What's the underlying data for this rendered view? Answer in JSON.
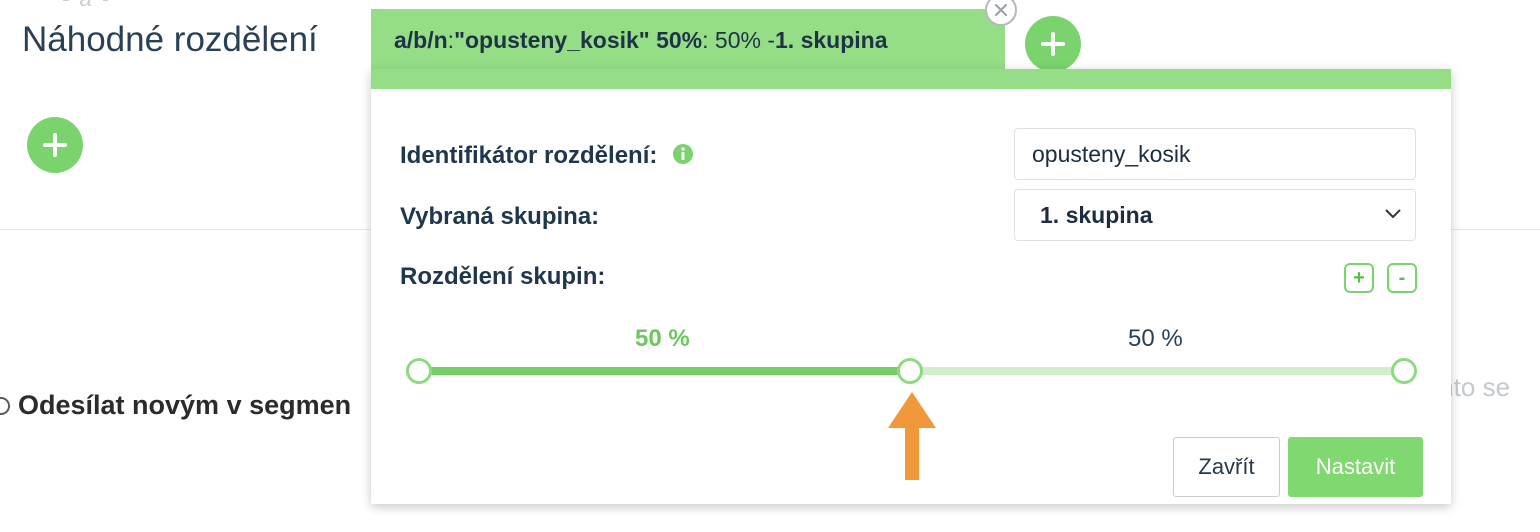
{
  "background": {
    "fragment": "- a -",
    "title": "Náhodné rozdělení",
    "send_text": "Odesílat novým v segmen",
    "right_fragment": "mto se"
  },
  "tab": {
    "prefix": "a/b/n",
    "sep1": ": ",
    "quoted_id": "\"opusteny_kosik\" 50%",
    "middle": " : 50% - ",
    "group": "1. skupina"
  },
  "panel": {
    "identifier_label": "Identifikátor rozdělení:",
    "identifier_value": "opusteny_kosik",
    "selected_group_label": "Vybraná skupina:",
    "selected_group_value": "1. skupina",
    "distribution_label": "Rozdělení skupin:",
    "add_group_symbol": "+",
    "remove_group_symbol": "-",
    "split": {
      "group_a_percent": "50 %",
      "group_b_percent": "50 %",
      "handle_position": 0.5
    },
    "close_button": "Zavřít",
    "submit_button": "Nastavit"
  },
  "colors": {
    "accent_green": "#7bd36e",
    "tab_green": "#95dd87",
    "arrow_orange": "#f0983a",
    "text_dark": "#20364c"
  },
  "icons": {
    "add": "plus-icon",
    "close": "close-icon",
    "info": "info-icon",
    "dropdown": "chevron-down-icon",
    "annotation": "arrow-up-icon"
  }
}
